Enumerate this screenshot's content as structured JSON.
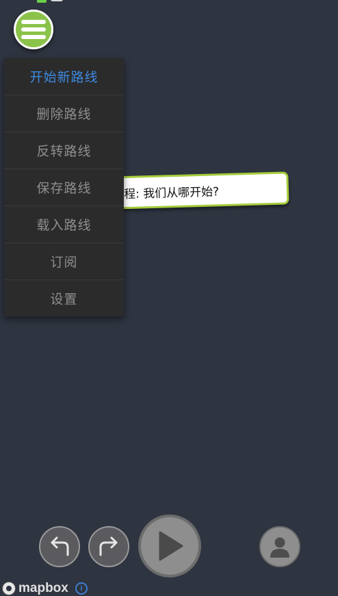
{
  "menu": {
    "items": [
      {
        "label": "开始新路线",
        "active": true
      },
      {
        "label": "删除路线",
        "active": false
      },
      {
        "label": "反转路线",
        "active": false
      },
      {
        "label": "保存路线",
        "active": false
      },
      {
        "label": "载入路线",
        "active": false
      },
      {
        "label": "订阅",
        "active": false
      },
      {
        "label": "设置",
        "active": false
      }
    ]
  },
  "tutorial": {
    "text": "程: 我们从哪开始?"
  },
  "controls": {
    "undo_icon": "undo-arrow-icon",
    "redo_icon": "redo-arrow-icon",
    "play_icon": "play-icon",
    "profile_icon": "person-icon"
  },
  "attribution": {
    "brand": "mapbox",
    "info_icon": "info-icon"
  },
  "colors": {
    "background": "#2e3440",
    "accent_green": "#8bc34a",
    "active_blue": "#3d8ae0",
    "menu_text": "#8f8f8f",
    "menu_bg": "#2b2b2b"
  }
}
